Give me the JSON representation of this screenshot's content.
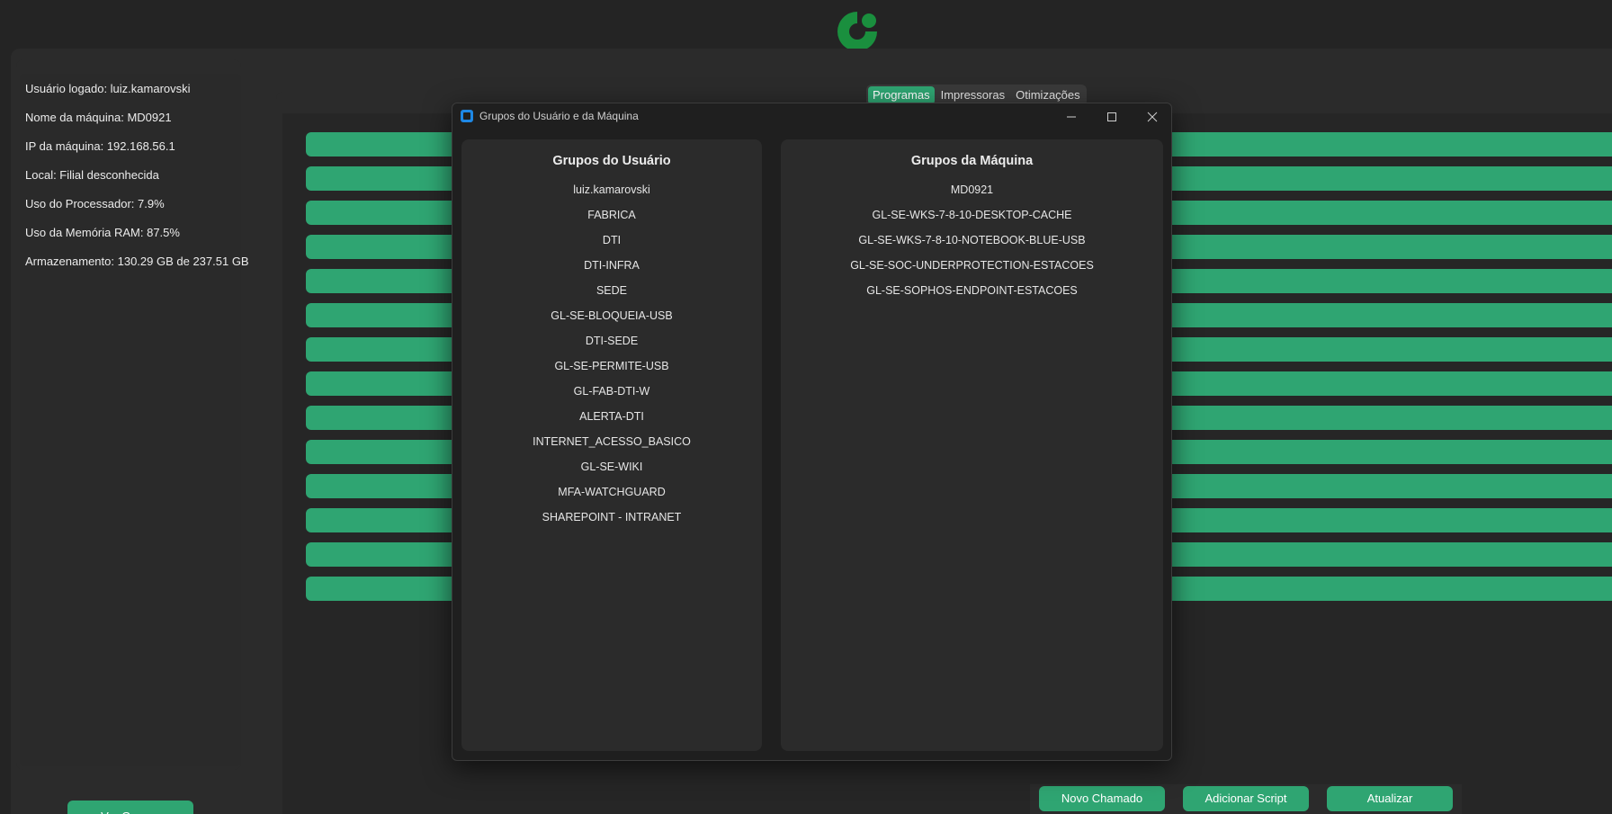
{
  "colors": {
    "accent": "#2fa572",
    "background": "#242424",
    "panel": "#2b2b2b",
    "logo": "#1a8f3e"
  },
  "logo": {
    "icon": "company-logo-icon"
  },
  "system_info": [
    "Usuário logado: luiz.kamarovski",
    "Nome da máquina: MD0921",
    "IP da máquina: 192.168.56.1",
    "Local: Filial desconhecida",
    "Uso do Processador: 7.9%",
    "Uso da Memória RAM: 87.5%",
    "Armazenamento: 130.29 GB de 237.51 GB"
  ],
  "sidebar": {
    "ver_grupos_label": "Ver Grupos"
  },
  "tabs": [
    {
      "label": "Programas",
      "active": true
    },
    {
      "label": "Impressoras",
      "active": false
    },
    {
      "label": "Otimizações",
      "active": false
    }
  ],
  "program_bar_count": 14,
  "bottom_buttons": [
    "Novo Chamado",
    "Adicionar Script",
    "Atualizar"
  ],
  "modal": {
    "title": "Grupos do Usuário e da Máquina",
    "controls": [
      "minimize-icon",
      "maximize-icon",
      "close-icon"
    ],
    "user_groups": {
      "title": "Grupos do Usuário",
      "items": [
        "luiz.kamarovski",
        "FABRICA",
        "DTI",
        "DTI-INFRA",
        "SEDE",
        "GL-SE-BLOQUEIA-USB",
        "DTI-SEDE",
        "GL-SE-PERMITE-USB",
        "GL-FAB-DTI-W",
        "ALERTA-DTI",
        "INTERNET_ACESSO_BASICO",
        "GL-SE-WIKI",
        "MFA-WATCHGUARD",
        "SHAREPOINT - INTRANET"
      ]
    },
    "machine_groups": {
      "title": "Grupos da Máquina",
      "items": [
        "MD0921",
        "GL-SE-WKS-7-8-10-DESKTOP-CACHE",
        "GL-SE-WKS-7-8-10-NOTEBOOK-BLUE-USB",
        "GL-SE-SOC-UNDERPROTECTION-ESTACOES",
        "GL-SE-SOPHOS-ENDPOINT-ESTACOES"
      ]
    }
  }
}
